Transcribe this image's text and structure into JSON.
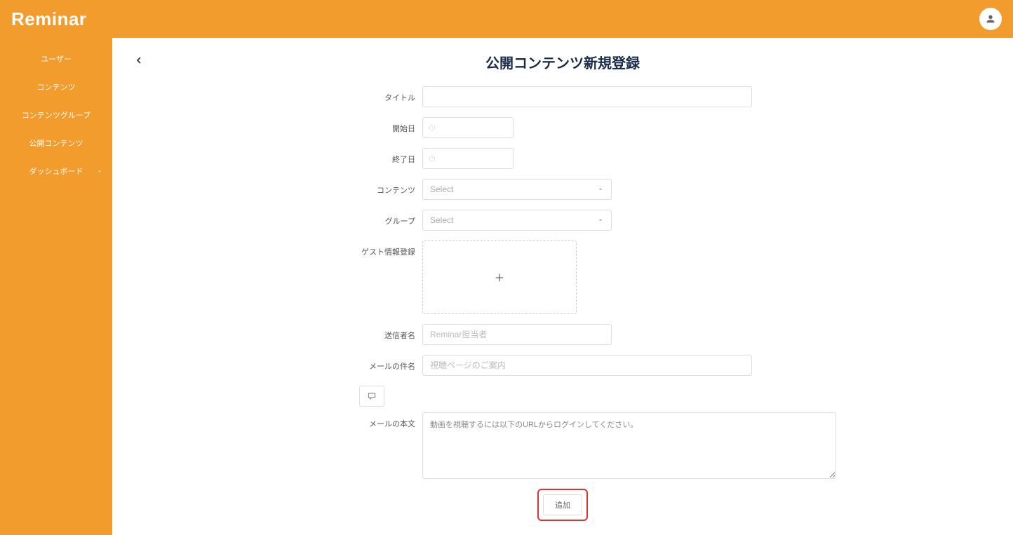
{
  "header": {
    "logo": "Reminar"
  },
  "sidebar": {
    "items": [
      {
        "label": "ユーザー"
      },
      {
        "label": "コンテンツ"
      },
      {
        "label": "コンテンツグループ"
      },
      {
        "label": "公開コンテンツ"
      },
      {
        "label": "ダッシュボード",
        "has_children": true
      }
    ]
  },
  "page": {
    "title": "公開コンテンツ新規登録"
  },
  "form": {
    "title_label": "タイトル",
    "start_date_label": "開始日",
    "end_date_label": "終了日",
    "contents_label": "コンテンツ",
    "contents_placeholder": "Select",
    "group_label": "グループ",
    "group_placeholder": "Select",
    "guest_info_label": "ゲスト情報登録",
    "sender_label": "送信者名",
    "sender_placeholder": "Reminar担当者",
    "mail_subject_label": "メールの件名",
    "mail_subject_placeholder": "視聴ページのご案内",
    "mail_body_label": "メールの本文",
    "mail_body_value": "動画を視聴するには以下のURLからログインしてください。",
    "submit_label": "追加"
  }
}
